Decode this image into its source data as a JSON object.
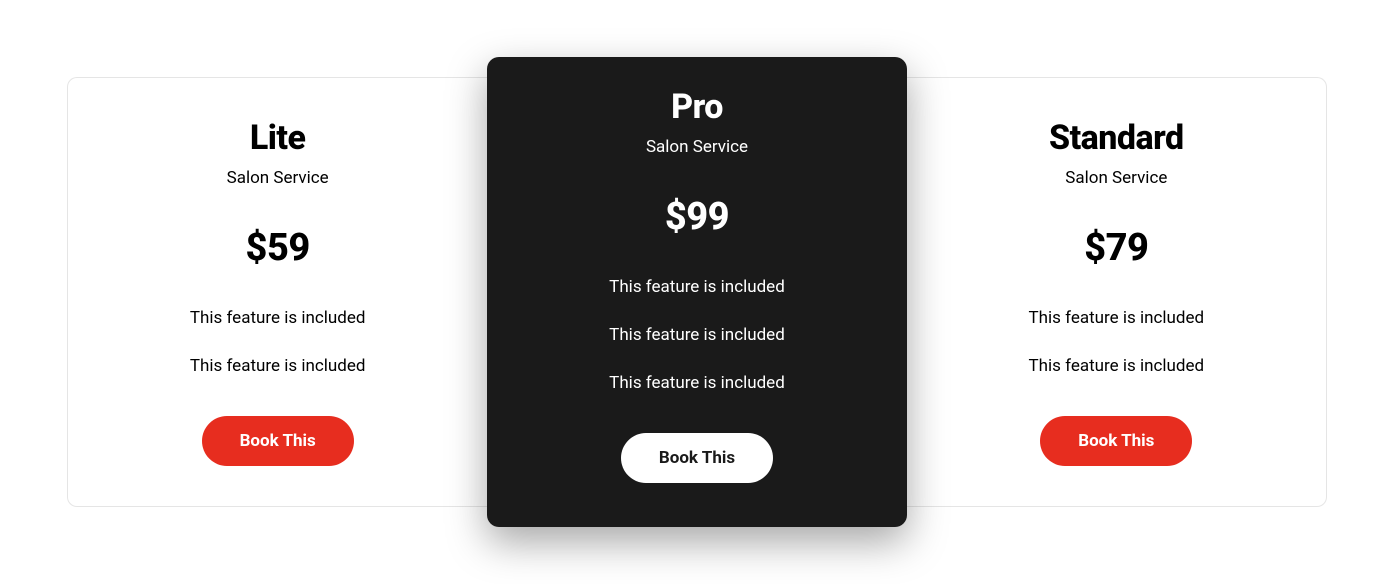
{
  "plans": [
    {
      "name": "Lite",
      "subtitle": "Salon Service",
      "price": "$59",
      "features": [
        "This feature is included",
        "This feature is included"
      ],
      "button_label": "Book This"
    },
    {
      "name": "Pro",
      "subtitle": "Salon Service",
      "price": "$99",
      "features": [
        "This feature is included",
        "This feature is included",
        "This feature is included"
      ],
      "button_label": "Book This"
    },
    {
      "name": "Standard",
      "subtitle": "Salon Service",
      "price": "$79",
      "features": [
        "This feature is included",
        "This feature is included"
      ],
      "button_label": "Book This"
    }
  ]
}
